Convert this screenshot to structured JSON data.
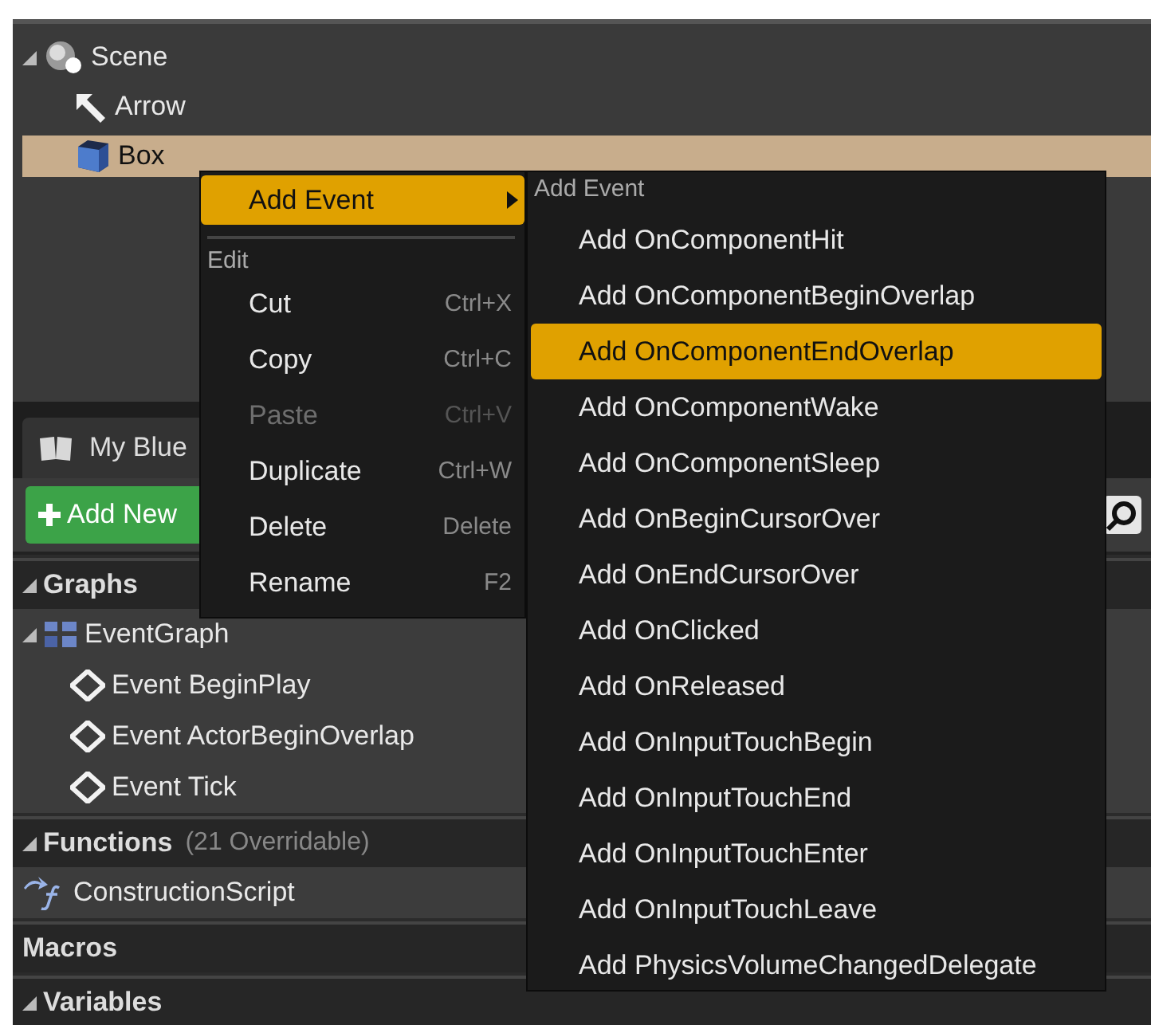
{
  "scene_tree": {
    "items": [
      {
        "label": "Scene",
        "kind": "scene",
        "expanded": true,
        "selected": false,
        "children": [
          {
            "label": "Arrow",
            "kind": "arrow",
            "selected": false
          },
          {
            "label": "Box",
            "kind": "box",
            "selected": true
          }
        ]
      }
    ]
  },
  "my_blueprint": {
    "tab": {
      "label": "My Blue"
    },
    "add_button": {
      "label": "Add New"
    },
    "sections": [
      {
        "title": "Graphs",
        "expanded": true,
        "children": [
          {
            "label": "EventGraph",
            "kind": "graph",
            "expanded": true,
            "children": [
              {
                "label": "Event BeginPlay",
                "kind": "event"
              },
              {
                "label": "Event ActorBeginOverlap",
                "kind": "event"
              },
              {
                "label": "Event Tick",
                "kind": "event"
              }
            ]
          }
        ]
      },
      {
        "title": "Functions",
        "count": "(21 Overridable)",
        "expanded": true,
        "children": [
          {
            "label": "ConstructionScript",
            "kind": "function"
          }
        ]
      },
      {
        "title": "Macros"
      },
      {
        "title": "Variables",
        "expanded": true
      }
    ]
  },
  "context_menu": {
    "items": [
      {
        "kind": "submenu",
        "label": "Add Event",
        "selected": true
      },
      {
        "kind": "header",
        "label": "Edit"
      },
      {
        "kind": "item",
        "label": "Cut",
        "shortcut": "Ctrl+X",
        "disabled": false
      },
      {
        "kind": "item",
        "label": "Copy",
        "shortcut": "Ctrl+C",
        "disabled": false
      },
      {
        "kind": "item",
        "label": "Paste",
        "shortcut": "Ctrl+V",
        "disabled": true
      },
      {
        "kind": "item",
        "label": "Duplicate",
        "shortcut": "Ctrl+W",
        "disabled": false
      },
      {
        "kind": "item",
        "label": "Delete",
        "shortcut": "Delete",
        "disabled": false
      },
      {
        "kind": "item",
        "label": "Rename",
        "shortcut": "F2",
        "disabled": false
      }
    ]
  },
  "submenu": {
    "header": "Add Event",
    "items": [
      {
        "label": "Add OnComponentHit",
        "selected": false
      },
      {
        "label": "Add OnComponentBeginOverlap",
        "selected": false
      },
      {
        "label": "Add OnComponentEndOverlap",
        "selected": true
      },
      {
        "label": "Add OnComponentWake",
        "selected": false
      },
      {
        "label": "Add OnComponentSleep",
        "selected": false
      },
      {
        "label": "Add OnBeginCursorOver",
        "selected": false
      },
      {
        "label": "Add OnEndCursorOver",
        "selected": false
      },
      {
        "label": "Add OnClicked",
        "selected": false
      },
      {
        "label": "Add OnReleased",
        "selected": false
      },
      {
        "label": "Add OnInputTouchBegin",
        "selected": false
      },
      {
        "label": "Add OnInputTouchEnd",
        "selected": false
      },
      {
        "label": "Add OnInputTouchEnter",
        "selected": false
      },
      {
        "label": "Add OnInputTouchLeave",
        "selected": false
      },
      {
        "label": "Add PhysicsVolumeChangedDelegate",
        "selected": false
      }
    ]
  }
}
